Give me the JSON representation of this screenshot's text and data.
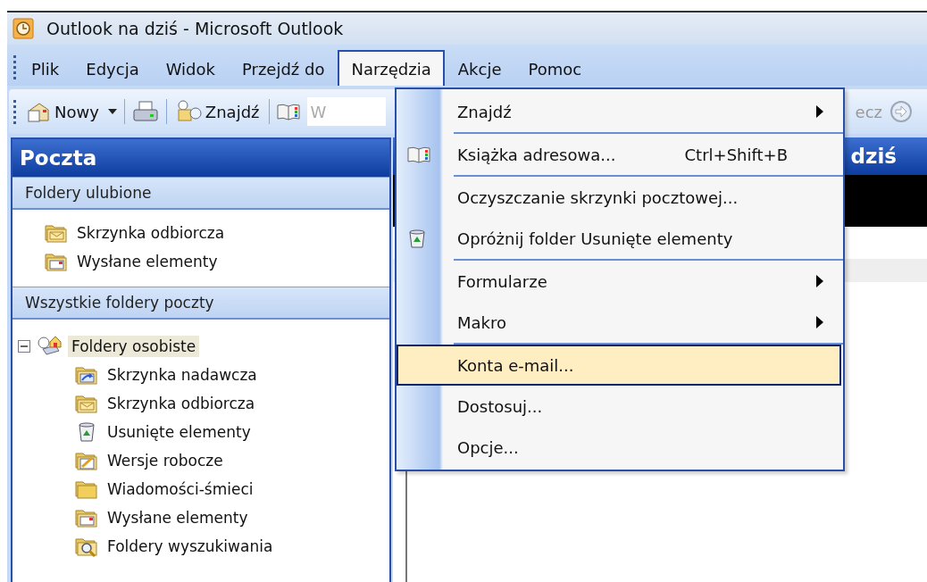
{
  "window": {
    "title": "Outlook na dziś - Microsoft Outlook"
  },
  "menu_bar": [
    {
      "label": "Plik",
      "selected": false
    },
    {
      "label": "Edycja",
      "selected": false
    },
    {
      "label": "Widok",
      "selected": false
    },
    {
      "label": "Przejdź do",
      "selected": false
    },
    {
      "label": "Narzędzia",
      "selected": true
    },
    {
      "label": "Akcje",
      "selected": false
    },
    {
      "label": "Pomoc",
      "selected": false
    }
  ],
  "toolbar": {
    "new_label": "Nowy",
    "find_label": "Znajdź",
    "search_field": {
      "placeholder": "W"
    },
    "right_text": "ecz"
  },
  "navigation_pane": {
    "title": "Poczta",
    "favorites_title": "Foldery ulubione",
    "favorites": [
      {
        "label": "Skrzynka odbiorcza",
        "kind": "inbox"
      },
      {
        "label": "Wysłane elementy",
        "kind": "sent"
      }
    ],
    "all_folders_title": "Wszystkie foldery poczty",
    "tree": [
      {
        "label": "Foldery osobiste",
        "kind": "root",
        "expanded": true,
        "selected": true,
        "children": [
          {
            "label": "Skrzynka nadawcza",
            "kind": "outbox",
            "selected": false
          },
          {
            "label": "Skrzynka odbiorcza",
            "kind": "inbox",
            "selected": false
          },
          {
            "label": "Usunięte elementy",
            "kind": "deleted",
            "selected": false
          },
          {
            "label": "Wersje robocze",
            "kind": "drafts",
            "selected": false
          },
          {
            "label": "Wiadomości-śmieci",
            "kind": "junk",
            "selected": false
          },
          {
            "label": "Wysłane elementy",
            "kind": "sent",
            "selected": false
          },
          {
            "label": "Foldery wyszukiwania",
            "kind": "search",
            "selected": false
          }
        ]
      }
    ]
  },
  "main_pane": {
    "title": "dziś"
  },
  "dropdown_menu": [
    {
      "kind": "submenu",
      "label": "Znajdź",
      "selected": false
    },
    {
      "kind": "separator"
    },
    {
      "kind": "command",
      "label": "Książka adresowa...",
      "shortcut": "Ctrl+Shift+B",
      "selected": false
    },
    {
      "kind": "separator"
    },
    {
      "kind": "command",
      "label": "Oczyszczanie skrzynki pocztowej...",
      "selected": false
    },
    {
      "kind": "command",
      "label": "Opróżnij folder Usunięte elementy",
      "selected": false
    },
    {
      "kind": "separator"
    },
    {
      "kind": "submenu",
      "label": "Formularze",
      "selected": false
    },
    {
      "kind": "submenu",
      "label": "Makro",
      "selected": false
    },
    {
      "kind": "separator"
    },
    {
      "kind": "command",
      "label": "Konta e-mail...",
      "selected": true
    },
    {
      "kind": "command",
      "label": "Dostosuj...",
      "selected": false
    },
    {
      "kind": "command",
      "label": "Opcje...",
      "selected": false
    }
  ]
}
